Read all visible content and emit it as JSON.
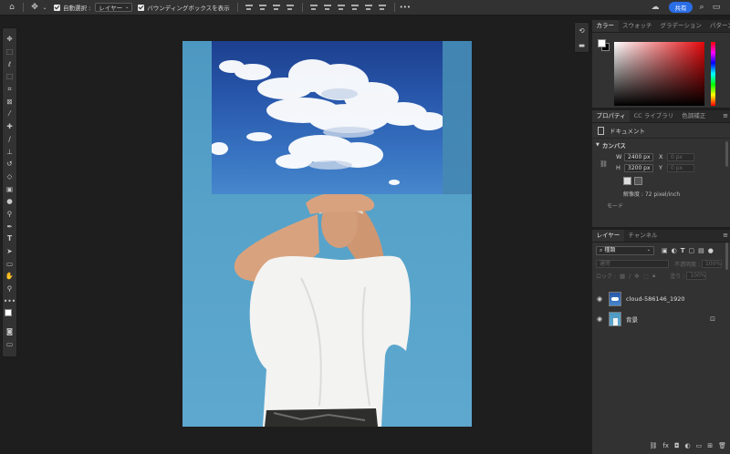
{
  "options_bar": {
    "auto_select_label": "自動選択 :",
    "auto_select_target": "レイヤー",
    "bounding_box_label": "バウンディングボックスを表示",
    "more_label": "•••",
    "share_label": "共有"
  },
  "toolbar": {
    "tools": [
      "move-tool",
      "artboard-tool",
      "marquee-tool",
      "lasso-tool",
      "object-select-tool",
      "crop-tool",
      "frame-tool",
      "eyedropper-tool",
      "healing-brush-tool",
      "brush-tool",
      "clone-stamp-tool",
      "history-brush-tool",
      "eraser-tool",
      "gradient-tool",
      "blur-tool",
      "dodge-tool",
      "pen-tool",
      "type-tool",
      "path-select-tool",
      "rectangle-tool",
      "hand-tool",
      "zoom-tool",
      "more-tools"
    ]
  },
  "color_panel": {
    "tabs": [
      "カラー",
      "スウォッチ",
      "グラデーション",
      "パターン"
    ],
    "foreground": "#ffffff",
    "background": "#000000",
    "hue_color": "#e3080b"
  },
  "properties_panel": {
    "tabs": [
      "プロパティ",
      "CC ライブラリ",
      "色調補正"
    ],
    "document_label": "ドキュメント",
    "canvas_section": "カンバス",
    "w_label": "W",
    "w_value": "2400 px",
    "h_label": "H",
    "h_value": "3200 px",
    "x_label": "X",
    "x_placeholder": "0 px",
    "y_label": "Y",
    "y_placeholder": "0 px",
    "resolution": "解像度 : 72 pixel/inch",
    "mode_label": "モード"
  },
  "layers_panel": {
    "tabs": [
      "レイヤー",
      "チャンネル"
    ],
    "filter_kind": "種類",
    "blend_mode": "通常",
    "opacity_label": "不透明度 :",
    "opacity_value": "100%",
    "lock_label": "ロック :",
    "fill_label": "塗り :",
    "fill_value": "100%",
    "layers": [
      {
        "name": "cloud-586146_1920",
        "visible": true,
        "locked": false
      },
      {
        "name": "背景",
        "visible": true,
        "locked": true
      }
    ]
  }
}
